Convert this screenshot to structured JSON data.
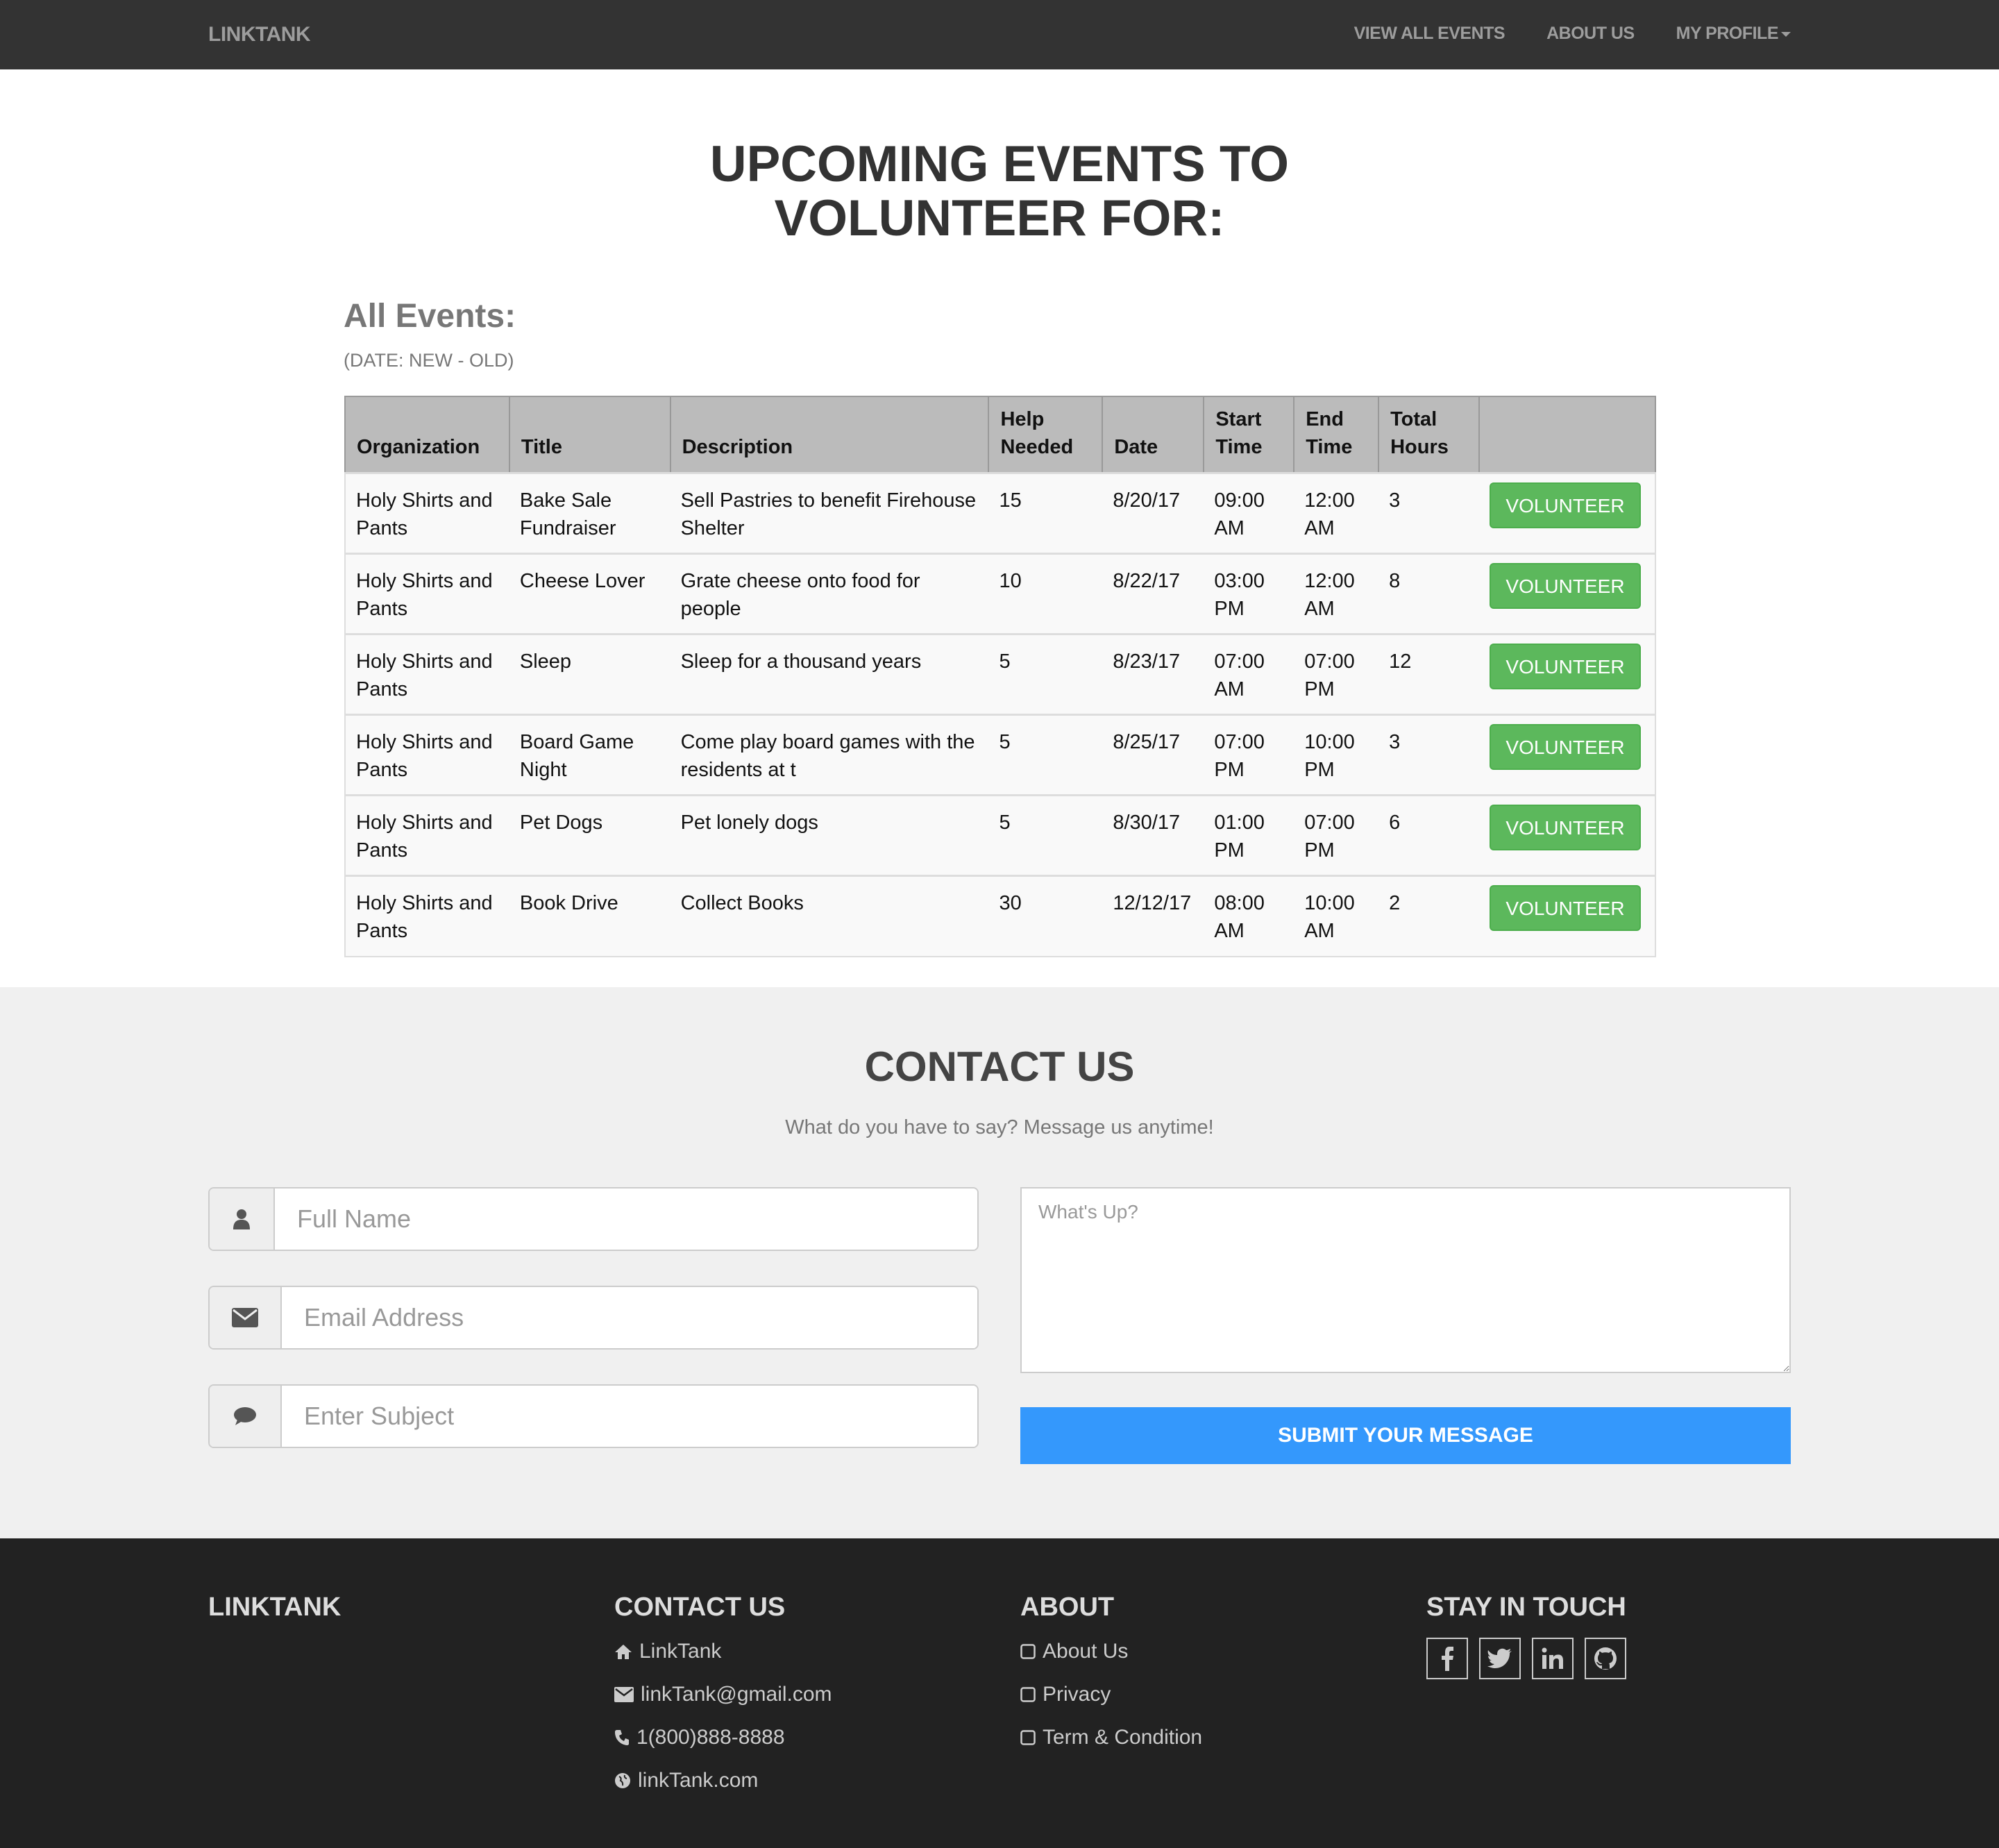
{
  "navbar": {
    "brand": "LINKTANK",
    "links": [
      "VIEW ALL EVENTS",
      "ABOUT US",
      "MY PROFILE"
    ]
  },
  "hero": {
    "title_line1": "UPCOMING EVENTS TO",
    "title_line2": "VOLUNTEER FOR:"
  },
  "events": {
    "heading": "All Events:",
    "sort_label": "(DATE: NEW - OLD)",
    "columns": [
      "Organization",
      "Title",
      "Description",
      "Help Needed",
      "Date",
      "Start Time",
      "End Time",
      "Total Hours"
    ],
    "button_label": "VOLUNTEER",
    "rows": [
      {
        "org": "Holy Shirts and Pants",
        "title": "Bake Sale Fundraiser",
        "desc": "Sell Pastries to benefit Firehouse Shelter",
        "help": "15",
        "date": "8/20/17",
        "start": "09:00 AM",
        "end": "12:00 AM",
        "hours": "3"
      },
      {
        "org": "Holy Shirts and Pants",
        "title": "Cheese Lover",
        "desc": "Grate cheese onto food for people",
        "help": "10",
        "date": "8/22/17",
        "start": "03:00 PM",
        "end": "12:00 AM",
        "hours": "8"
      },
      {
        "org": "Holy Shirts and Pants",
        "title": "Sleep",
        "desc": "Sleep for a thousand years",
        "help": "5",
        "date": "8/23/17",
        "start": "07:00 AM",
        "end": "07:00 PM",
        "hours": "12"
      },
      {
        "org": "Holy Shirts and Pants",
        "title": "Board Game Night",
        "desc": "Come play board games with the residents at t",
        "help": "5",
        "date": "8/25/17",
        "start": "07:00 PM",
        "end": "10:00 PM",
        "hours": "3"
      },
      {
        "org": "Holy Shirts and Pants",
        "title": "Pet Dogs",
        "desc": "Pet lonely dogs",
        "help": "5",
        "date": "8/30/17",
        "start": "01:00 PM",
        "end": "07:00 PM",
        "hours": "6"
      },
      {
        "org": "Holy Shirts and Pants",
        "title": "Book Drive",
        "desc": "Collect Books",
        "help": "30",
        "date": "12/12/17",
        "start": "08:00 AM",
        "end": "10:00 AM",
        "hours": "2"
      }
    ]
  },
  "contact": {
    "title": "CONTACT US",
    "subtitle": "What do you have to say? Message us anytime!",
    "name_placeholder": "Full Name",
    "email_placeholder": "Email Address",
    "subject_placeholder": "Enter Subject",
    "message_placeholder": "What's Up?",
    "submit_label": "SUBMIT YOUR MESSAGE"
  },
  "footer": {
    "brand": "LINKTANK",
    "contact_heading": "CONTACT US",
    "contact_items": [
      "LinkTank",
      "linkTank@gmail.com",
      "1(800)888-8888",
      "linkTank.com"
    ],
    "about_heading": "ABOUT",
    "about_items": [
      "About Us",
      "Privacy",
      "Term & Condition"
    ],
    "social_heading": "STAY IN TOUCH",
    "social_icons": [
      "facebook-icon",
      "twitter-icon",
      "linkedin-icon",
      "github-icon"
    ]
  },
  "colors": {
    "navbar": "#333333",
    "volunteer": "#5cb85c",
    "submit": "#3498fc",
    "footer": "#222222",
    "contact_bg": "#f0f0f0"
  }
}
